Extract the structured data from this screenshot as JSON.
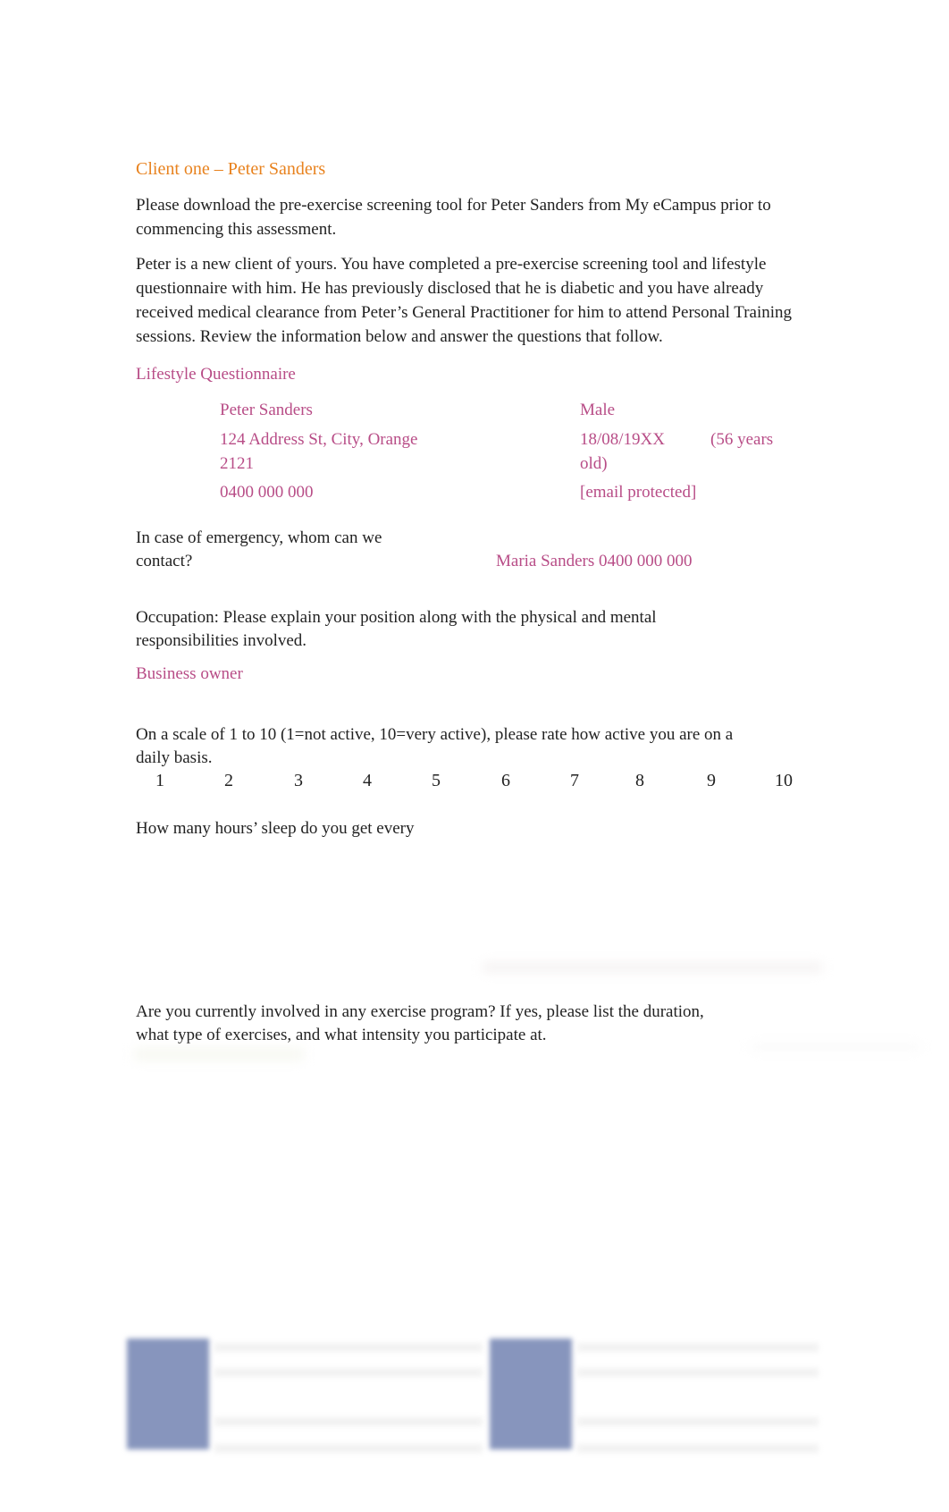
{
  "document": {
    "heading": "Client one – Peter Sanders",
    "intro_1": "Please download the pre-exercise screening tool for Peter Sanders from My eCampus prior to commencing this assessment.",
    "intro_2": "Peter is a new client of yours.  You have completed a pre-exercise screening tool and lifestyle questionnaire with him.    He has previously disclosed that he is diabetic and you have already received medical clearance from Peter’s General Practitioner for him to attend Personal Training sessions.  Review the information below and answer the questions that follow.",
    "section_title": "Lifestyle Questionnaire",
    "client": {
      "name": "Peter Sanders",
      "gender": "Male",
      "address_line_1": "124 Address St, City, Orange",
      "address_line_2": "2121",
      "dob": "18/08/19XX",
      "age_note_1": "(56 years",
      "age_note_2": "old)",
      "phone": "0400 000 000",
      "email": "[email protected]"
    },
    "emergency": {
      "question_line_1": "In case of emergency, whom can we",
      "question_line_2": "contact?",
      "answer": "Maria Sanders 0400 000 000"
    },
    "occupation": {
      "question_line_1": "Occupation: Please explain your position along with the physical and mental",
      "question_line_2": "responsibilities involved.",
      "answer": "Business owner"
    },
    "activity": {
      "question_line_1": "On a scale of 1 to 10 (1=not active, 10=very active), please rate how active you are on a",
      "question_line_2": "daily basis.",
      "scale": [
        "1",
        "2",
        "3",
        "4",
        "5",
        "6",
        "7",
        "8",
        "9",
        "10"
      ]
    },
    "sleep": {
      "question": "How many hours’ sleep do you get every"
    },
    "exercise": {
      "question_line_1": "Are you currently involved in any exercise program? If yes, please list the duration,",
      "question_line_2": "what type of exercises, and what intensity you participate at."
    }
  }
}
